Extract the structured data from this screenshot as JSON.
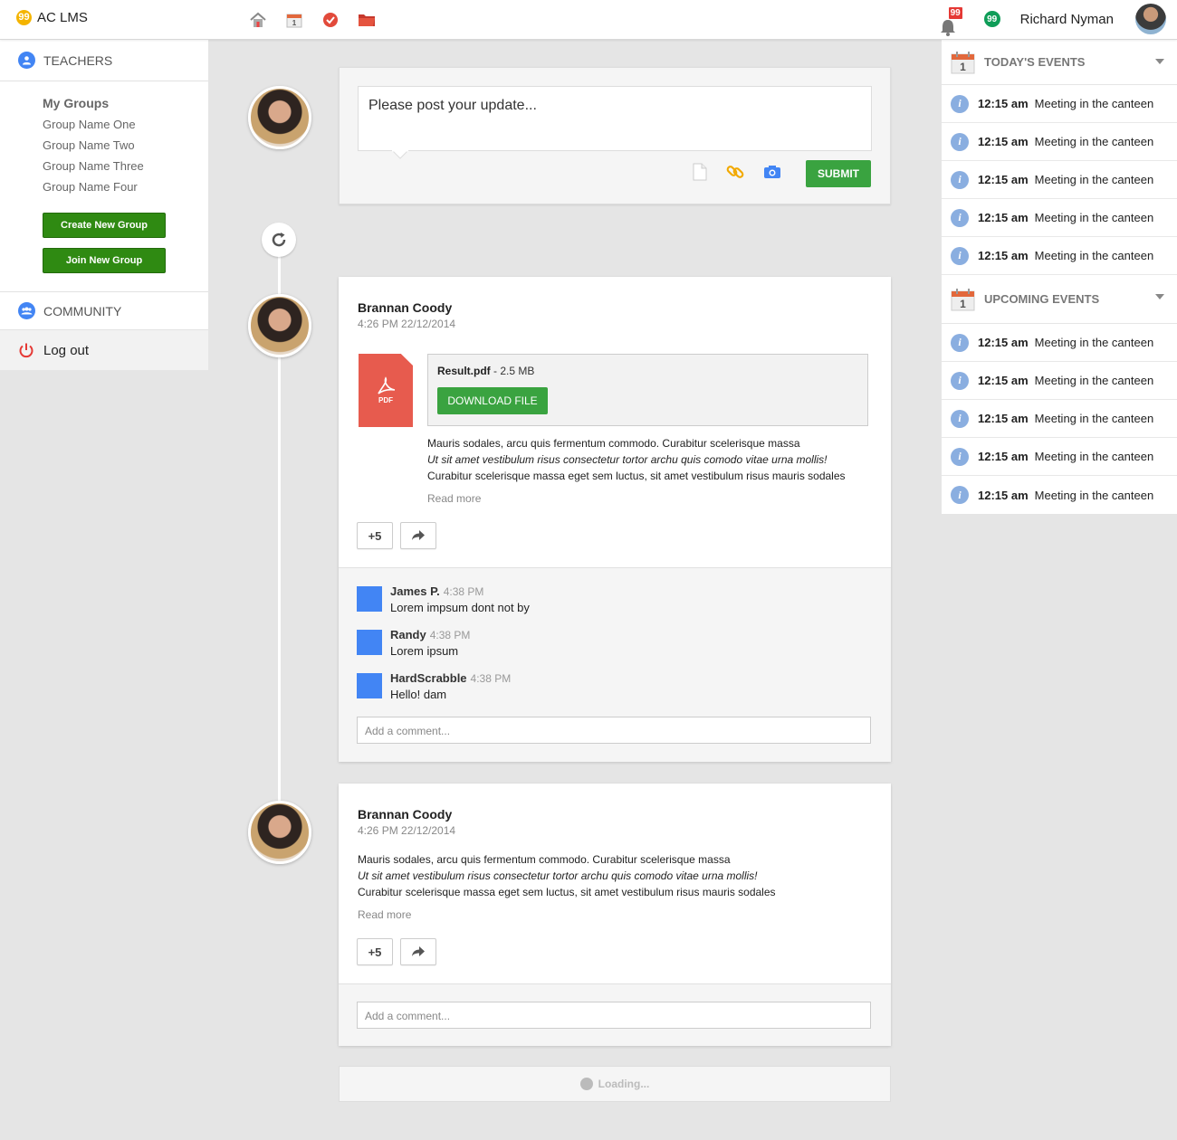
{
  "app": {
    "title": "AC LMS",
    "logo_glyph": "99"
  },
  "topbar": {
    "notification_count": "99",
    "hangouts_glyph": "99",
    "user_name": "Richard Nyman",
    "icons": [
      "home-icon",
      "calendar-icon",
      "check-circle-icon",
      "folder-icon"
    ]
  },
  "sidebar": {
    "teachers_label": "TEACHERS",
    "groups_title": "My Groups",
    "groups": [
      "Group Name One",
      "Group Name Two",
      "Group Name Three",
      "Group Name Four"
    ],
    "create_group_label": "Create New Group",
    "join_group_label": "Join New Group",
    "community_label": "COMMUNITY",
    "logout_label": "Log out"
  },
  "composer": {
    "placeholder": "Please post your update...",
    "submit_label": "SUBMIT"
  },
  "posts": [
    {
      "author": "Brannan Coody",
      "time": "4:26 PM 22/12/2014",
      "file_name": "Result.pdf",
      "file_size": " - 2.5 MB",
      "pdf_label": "PDF",
      "download_label": "DOWNLOAD FILE",
      "line1": "Mauris sodales, arcu quis fermentum commodo. Curabitur scelerisque massa",
      "line2": "Ut sit amet vestibulum risus consectetur tortor archu quis comodo vitae urna mollis!",
      "line3": "Curabitur scelerisque massa eget sem luctus, sit amet vestibulum risus mauris sodales",
      "read_more": "Read more",
      "plus_label": "+5",
      "comments": [
        {
          "name": "James P.",
          "time": "4:38 PM",
          "text": "Lorem impsum dont not by"
        },
        {
          "name": "Randy",
          "time": "4:38 PM",
          "text": "Lorem ipsum"
        },
        {
          "name": "HardScrabble",
          "time": "4:38 PM",
          "text": "Hello! dam"
        }
      ],
      "comment_placeholder": "Add a comment..."
    },
    {
      "author": "Brannan Coody",
      "time": "4:26 PM 22/12/2014",
      "line1": "Mauris sodales, arcu quis fermentum commodo. Curabitur scelerisque massa",
      "line2": "Ut sit amet vestibulum risus consectetur tortor archu quis comodo vitae urna mollis!",
      "line3": "Curabitur scelerisque massa eget sem luctus, sit amet vestibulum risus mauris sodales",
      "read_more": "Read more",
      "plus_label": "+5",
      "comment_placeholder": "Add a comment..."
    }
  ],
  "loading_label": "Loading...",
  "events": {
    "today_title": "TODAY'S EVENTS",
    "upcoming_title": "UPCOMING EVENTS",
    "calendar_day": "1",
    "today": [
      {
        "time": "12:15 am",
        "title": "Meeting in the canteen"
      },
      {
        "time": "12:15 am",
        "title": "Meeting in the canteen"
      },
      {
        "time": "12:15 am",
        "title": "Meeting in the canteen"
      },
      {
        "time": "12:15 am",
        "title": "Meeting in the canteen"
      },
      {
        "time": "12:15 am",
        "title": "Meeting in the canteen"
      }
    ],
    "upcoming": [
      {
        "time": "12:15 am",
        "title": "Meeting in the canteen"
      },
      {
        "time": "12:15 am",
        "title": "Meeting in the canteen"
      },
      {
        "time": "12:15 am",
        "title": "Meeting in the canteen"
      },
      {
        "time": "12:15 am",
        "title": "Meeting in the canteen"
      },
      {
        "time": "12:15 am",
        "title": "Meeting in the canteen"
      }
    ]
  },
  "colors": {
    "accent_green": "#3aa340",
    "sidebar_green": "#2f8a12",
    "pdf_red": "#e75b4e",
    "blue": "#4285f4",
    "badge_red": "#e53935"
  }
}
